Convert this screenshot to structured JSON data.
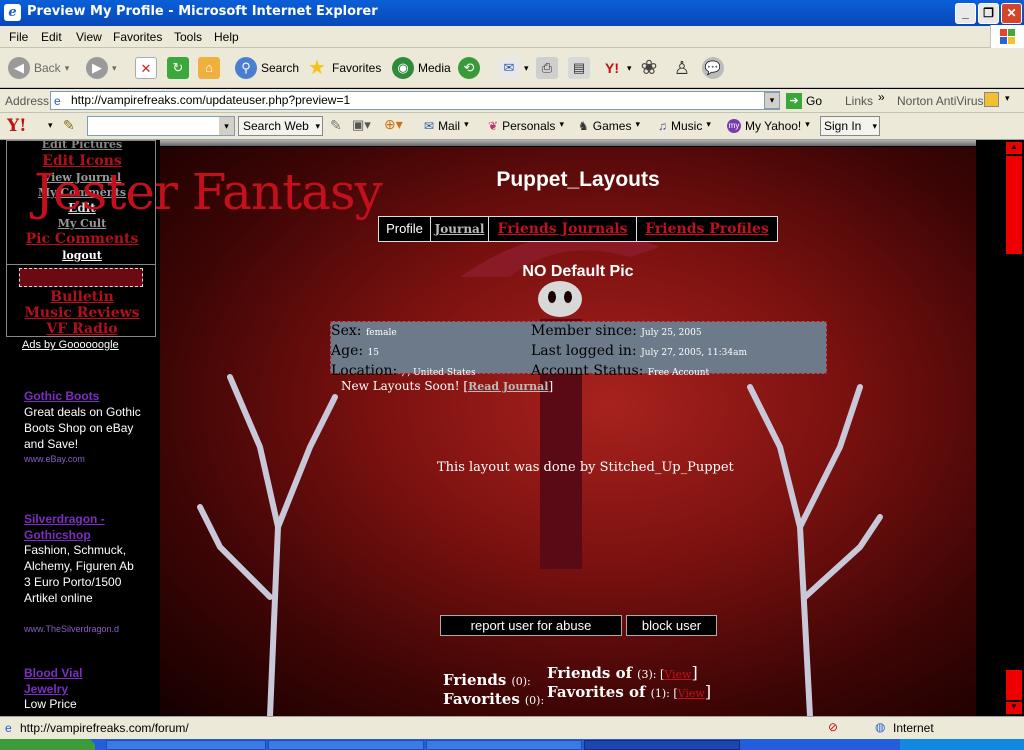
{
  "window": {
    "title": "Preview My Profile - Microsoft Internet Explorer"
  },
  "menu": [
    "File",
    "Edit",
    "View",
    "Favorites",
    "Tools",
    "Help"
  ],
  "toolbar": {
    "back": "Back",
    "search": "Search",
    "favorites": "Favorites",
    "media": "Media"
  },
  "address": {
    "label": "Address",
    "url": "http://vampirefreaks.com/updateuser.php?preview=1",
    "go": "Go",
    "links": "Links",
    "norton": "Norton AntiVirus"
  },
  "yahoo": {
    "logo": "Y!",
    "search_web": "Search Web",
    "mail": "Mail",
    "personals": "Personals",
    "games": "Games",
    "music": "Music",
    "my_yahoo": "My Yahoo!",
    "sign_in": "Sign In"
  },
  "leftnav": {
    "links": [
      "Edit Pictures",
      "Edit Icons",
      "View Journal",
      "My Comments",
      "Edit",
      "My Cult",
      "Pic Comments",
      "logout",
      "Bulletin",
      "Music Reviews",
      "VF Radio"
    ],
    "banner_text": "Jester Fantasy"
  },
  "ads": {
    "header": "Ads by Goooooogle",
    "items": [
      {
        "title": "Gothic Boots",
        "body": "Great deals on Gothic Boots Shop on eBay and Save!",
        "url": "www.eBay.com"
      },
      {
        "title": "Silverdragon - Gothicshop",
        "body": "Fashion, Schmuck, Alchemy, Figuren Ab 3 Euro Porto/1500 Artikel online",
        "url": "www.TheSilverdragon.d"
      },
      {
        "title": "Blood Vial Jewelry",
        "body": "Low Price",
        "url": ""
      }
    ]
  },
  "profile": {
    "username": "Puppet_Layouts",
    "tabs": [
      "Profile",
      "Journal",
      "Friends Journals",
      "Friends Profiles"
    ],
    "default_pic": "NO Default Pic",
    "sex_label": "Sex:",
    "sex": "female",
    "age_label": "Age:",
    "age": "15",
    "location_label": "Location:",
    "location": ", , United States",
    "member_since_label": "Member since:",
    "member_since": "July 25, 2005",
    "last_logged_label": "Last logged in:",
    "last_logged": "July 27, 2005, 11:34am",
    "account_status_label": "Account Status:",
    "account_status": "Free Account",
    "journal_entry": "New Layouts Soon!",
    "read_journal": "Read Journal",
    "credit": "This layout was done by Stitched_Up_Puppet",
    "report_button": "report user for abuse",
    "block_button": "block user",
    "friends_label": "Friends",
    "friends_count": "(0):",
    "favorites_label": "Favorites",
    "favorites_count": "(0):",
    "friends_of_label": "Friends of",
    "friends_of_count": "(3): [",
    "favorites_of_label": "Favorites of",
    "favorites_of_count": "(1): [",
    "view_label": "View"
  },
  "status": {
    "url": "http://vampirefreaks.com/forum/",
    "zone": "Internet"
  }
}
